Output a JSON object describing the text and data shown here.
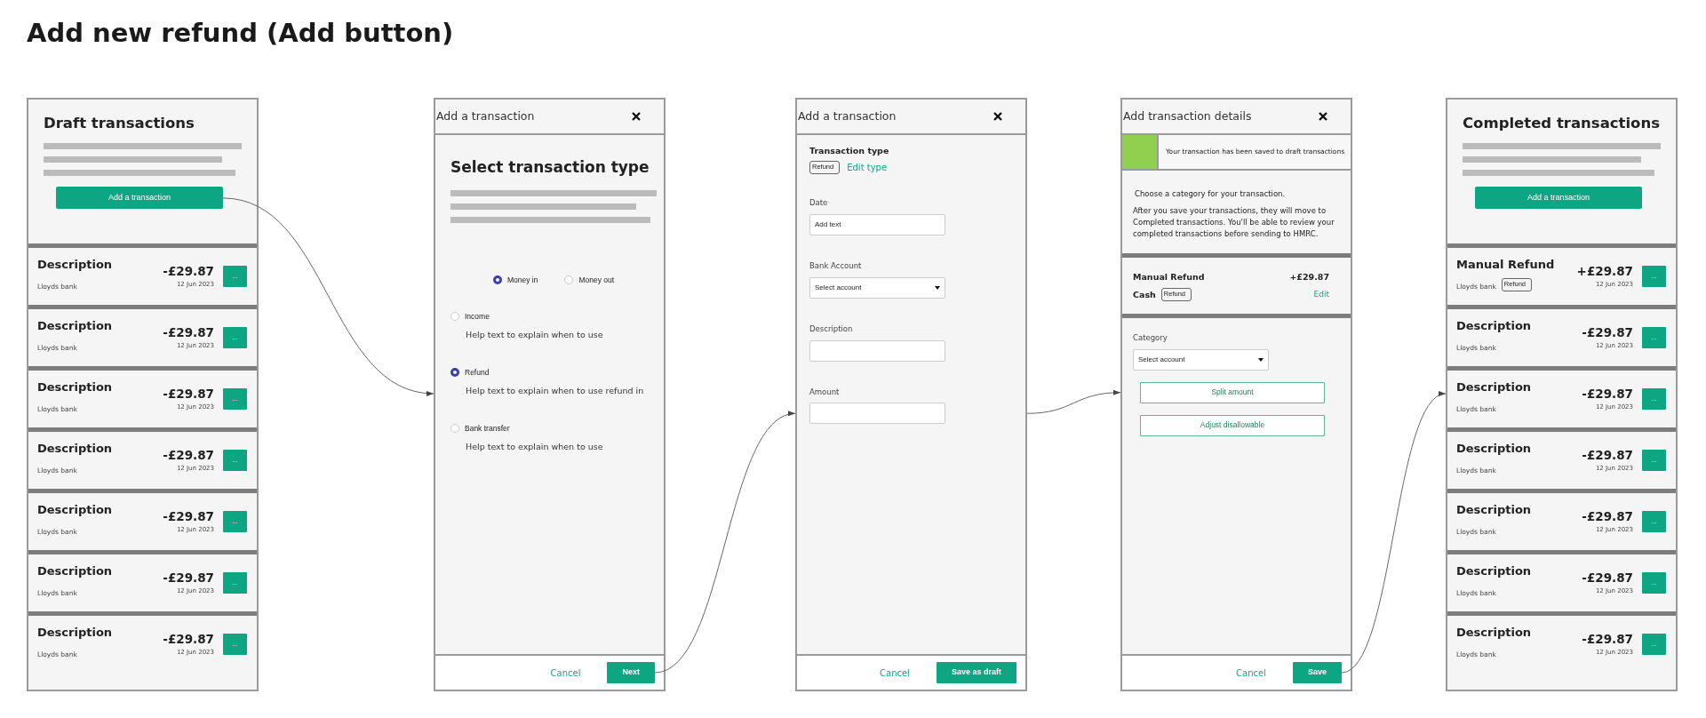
{
  "title": "Add new refund (Add button)",
  "screens": [
    {
      "kind": "list",
      "heading": "Draft transactions",
      "add_button": "Add a transaction",
      "rows": [
        {
          "description": "Description",
          "bank": "Lloyds bank",
          "amount": "-£29.87",
          "date": "12 Jun 2023",
          "menu": "..."
        },
        {
          "description": "Description",
          "bank": "Lloyds bank",
          "amount": "-£29.87",
          "date": "12 Jun 2023",
          "menu": "..."
        },
        {
          "description": "Description",
          "bank": "Lloyds bank",
          "amount": "-£29.87",
          "date": "12 Jun 2023",
          "menu": "..."
        },
        {
          "description": "Description",
          "bank": "Lloyds bank",
          "amount": "-£29.87",
          "date": "12 Jun 2023",
          "menu": "..."
        },
        {
          "description": "Description",
          "bank": "Lloyds bank",
          "amount": "-£29.87",
          "date": "12 Jun 2023",
          "menu": "..."
        },
        {
          "description": "Description",
          "bank": "Lloyds bank",
          "amount": "-£29.87",
          "date": "12 Jun 2023",
          "menu": "..."
        },
        {
          "description": "Description",
          "bank": "Lloyds bank",
          "amount": "-£29.87",
          "date": "12 Jun 2023",
          "menu": "..."
        }
      ]
    },
    {
      "kind": "type_select",
      "title": "Add a transaction",
      "heading": "Select transaction type",
      "direction": [
        {
          "label": "Money in",
          "selected": true
        },
        {
          "label": "Money out",
          "selected": false
        }
      ],
      "types": [
        {
          "label": "Income",
          "help": "Help text to explain when to use",
          "selected": false
        },
        {
          "label": "Refund",
          "help": "Help text to explain when to use refund in",
          "selected": true
        },
        {
          "label": "Bank transfer",
          "help": "Help text to explain when to use",
          "selected": false
        }
      ],
      "footer": {
        "cancel": "Cancel",
        "primary": "Next"
      }
    },
    {
      "kind": "form",
      "title": "Add a transaction",
      "type_label": "Transaction type",
      "type_tag": "Refund",
      "edit_link": "Edit type",
      "fields": [
        {
          "kind": "text",
          "label": "Date",
          "value": "Add text"
        },
        {
          "kind": "select",
          "label": "Bank Account",
          "value": "Select account"
        },
        {
          "kind": "text",
          "label": "Description"
        },
        {
          "kind": "text",
          "label": "Amount"
        }
      ],
      "footer": {
        "cancel": "Cancel",
        "primary": "Save as draft"
      }
    },
    {
      "kind": "details",
      "title": "Add transaction details",
      "notice": "Your transaction has been saved to draft transactions",
      "intro": "Choose a category for your transaction.",
      "info": "After you save your transactions, they will move to Completed transactions. You'll be able to review your completed transactions before sending to HMRC.",
      "summary": {
        "name": "Manual Refund",
        "amount": "+£29.87",
        "account": "Cash",
        "tag": "Refund",
        "edit": "Edit"
      },
      "category": {
        "label": "Category",
        "value": "Select account"
      },
      "actions": [
        "Split amount",
        "Adjust disallowable"
      ],
      "footer": {
        "cancel": "Cancel",
        "primary": "Save"
      }
    },
    {
      "kind": "list",
      "heading": "Completed transactions",
      "add_button": "Add a transaction",
      "rows": [
        {
          "description": "Manual Refund",
          "bank": "Lloyds bank",
          "tag": "Refund",
          "amount": "+£29.87",
          "date": "12 Jun 2023",
          "menu": "..."
        },
        {
          "description": "Description",
          "bank": "Lloyds bank",
          "amount": "-£29.87",
          "date": "12 Jun 2023",
          "menu": "..."
        },
        {
          "description": "Description",
          "bank": "Lloyds bank",
          "amount": "-£29.87",
          "date": "12 Jun 2023",
          "menu": "..."
        },
        {
          "description": "Description",
          "bank": "Lloyds bank",
          "amount": "-£29.87",
          "date": "12 Jun 2023",
          "menu": "..."
        },
        {
          "description": "Description",
          "bank": "Lloyds bank",
          "amount": "-£29.87",
          "date": "12 Jun 2023",
          "menu": "..."
        },
        {
          "description": "Description",
          "bank": "Lloyds bank",
          "amount": "-£29.87",
          "date": "12 Jun 2023",
          "menu": "..."
        },
        {
          "description": "Description",
          "bank": "Lloyds bank",
          "amount": "-£29.87",
          "date": "12 Jun 2023",
          "menu": "..."
        }
      ]
    }
  ]
}
